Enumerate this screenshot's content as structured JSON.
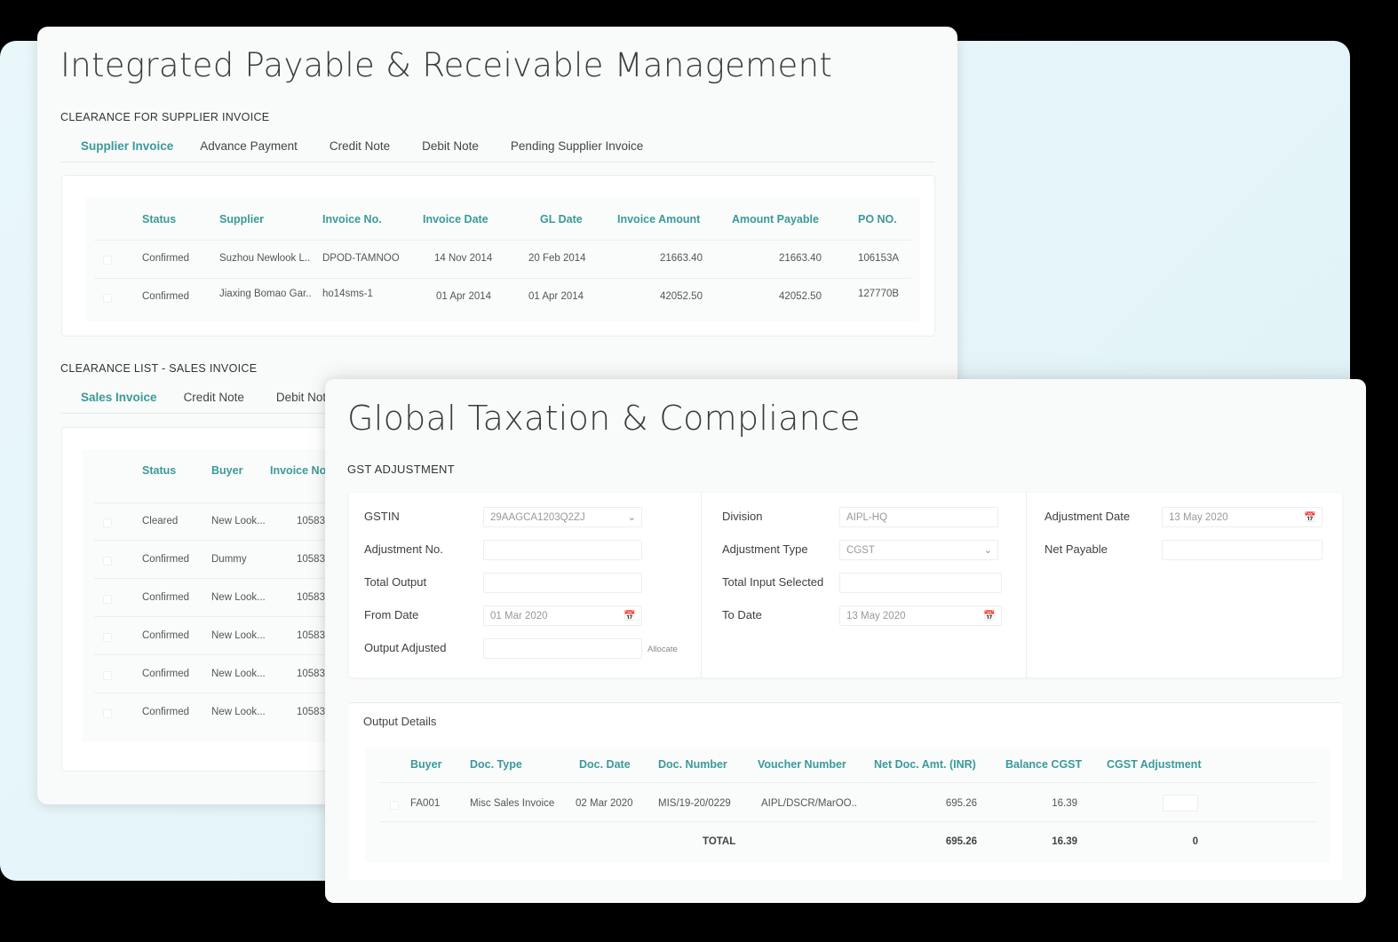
{
  "payables": {
    "title": "Integrated Payable & Receivable Management",
    "supplier_section": {
      "label": "CLEARANCE FOR SUPPLIER INVOICE",
      "tabs": [
        "Supplier Invoice",
        "Advance Payment",
        "Credit Note",
        "Debit Note",
        "Pending Supplier Invoice"
      ],
      "active_tab": "Supplier Invoice",
      "columns": [
        "Status",
        "Supplier",
        "Invoice No.",
        "Invoice Date",
        "GL Date",
        "Invoice Amount",
        "Amount Payable",
        "PO NO."
      ],
      "rows": [
        {
          "status": "Confirmed",
          "supplier": "Suzhou Newlook L..",
          "invoice_no": "DPOD-TAMNOO",
          "invoice_date": "14 Nov 2014",
          "gl_date": "20 Feb 2014",
          "invoice_amount": "21663.40",
          "amount_payable": "21663.40",
          "po_no": "106153A"
        },
        {
          "status": "Confirmed",
          "supplier": "Jiaxing Bomao Gar..",
          "invoice_no": "ho14sms-1",
          "invoice_date": "01 Apr 2014",
          "gl_date": "01 Apr 2014",
          "invoice_amount": "42052.50",
          "amount_payable": "42052.50",
          "po_no": "127770B"
        }
      ]
    },
    "sales_section": {
      "label": "CLEARANCE LIST - SALES INVOICE",
      "tabs": [
        "Sales Invoice",
        "Credit Note",
        "Debit Note"
      ],
      "active_tab": "Sales Invoice",
      "columns": [
        "Status",
        "Buyer",
        "Invoice No"
      ],
      "rows": [
        {
          "status": "Cleared",
          "buyer": "New Look...",
          "invoice_no": "10583"
        },
        {
          "status": "Confirmed",
          "buyer": "Dummy",
          "invoice_no": "10583"
        },
        {
          "status": "Confirmed",
          "buyer": "New Look...",
          "invoice_no": "10583"
        },
        {
          "status": "Confirmed",
          "buyer": "New Look...",
          "invoice_no": "10583"
        },
        {
          "status": "Confirmed",
          "buyer": "New Look...",
          "invoice_no": "10583"
        },
        {
          "status": "Confirmed",
          "buyer": "New Look...",
          "invoice_no": "10583"
        }
      ]
    }
  },
  "taxation": {
    "title": "Global Taxation & Compliance",
    "section_label": "GST ADJUSTMENT",
    "form": {
      "gstin": {
        "label": "GSTIN",
        "value": "29AAGCA1203Q2ZJ",
        "icon": "chevron-down-icon"
      },
      "adjustment_no": {
        "label": "Adjustment No.",
        "value": ""
      },
      "total_output": {
        "label": "Total Output",
        "value": ""
      },
      "from_date": {
        "label": "From Date",
        "value": "01 Mar 2020",
        "icon": "calendar-icon"
      },
      "output_adjusted": {
        "label": "Output Adjusted",
        "value": "",
        "action": "Allocate"
      },
      "division": {
        "label": "Division",
        "value": "AIPL-HQ"
      },
      "adjustment_type": {
        "label": "Adjustment Type",
        "value": "CGST",
        "icon": "chevron-down-icon"
      },
      "total_input_selected": {
        "label": "Total Input Selected",
        "value": ""
      },
      "to_date": {
        "label": "To Date",
        "value": "13 May 2020",
        "icon": "calendar-icon"
      },
      "adjustment_date": {
        "label": "Adjustment Date",
        "value": "13 May 2020",
        "icon": "calendar-icon"
      },
      "net_payable": {
        "label": "Net Payable",
        "value": ""
      }
    },
    "output_details": {
      "title": "Output Details",
      "columns": [
        "Buyer",
        "Doc. Type",
        "Doc. Date",
        "Doc. Number",
        "Voucher Number",
        "Net Doc. Amt. (INR)",
        "Balance CGST",
        "CGST Adjustment"
      ],
      "rows": [
        {
          "buyer": "FA001",
          "doc_type": "Misc Sales Invoice",
          "doc_date": "02 Mar 2020",
          "doc_number": "MIS/19-20/0229",
          "voucher_number": "AIPL/DSCR/MarOO..",
          "net_amt": "695.26",
          "balance_cgst": "16.39",
          "cgst_adjustment": ""
        }
      ],
      "total": {
        "label": "TOTAL",
        "net_amt": "695.26",
        "balance_cgst": "16.39",
        "cgst_adjustment": "0"
      }
    }
  }
}
